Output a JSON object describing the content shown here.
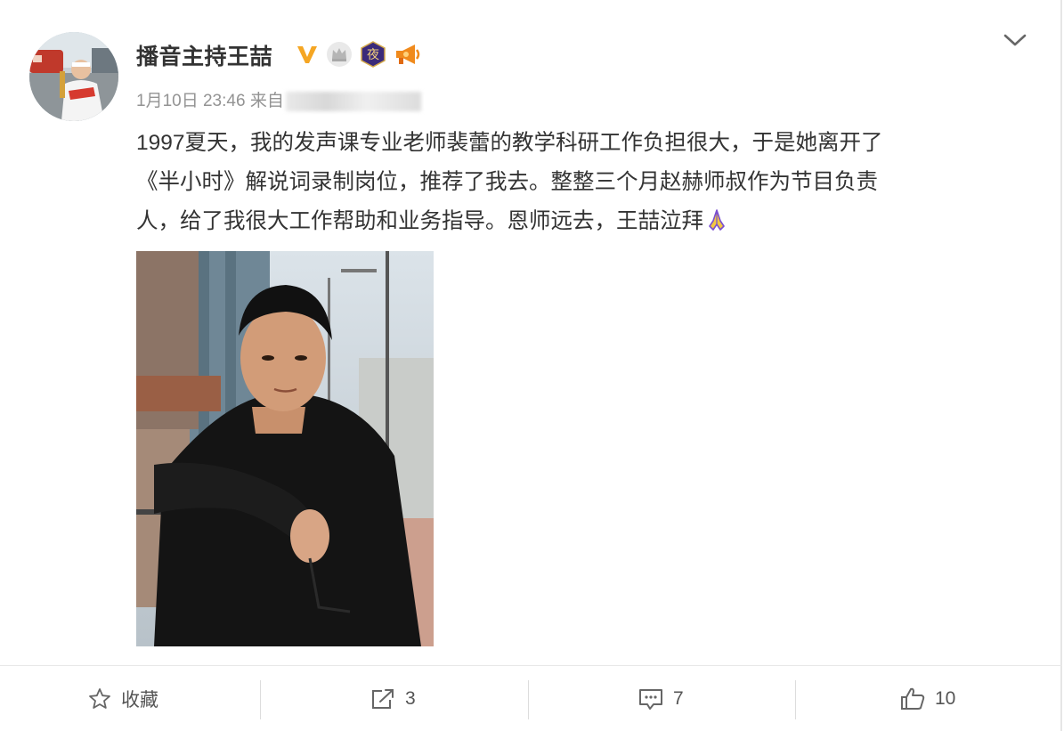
{
  "post": {
    "author": "播音主持王喆",
    "timestamp": "1月10日 23:46",
    "source_prefix": "来自",
    "text_line1": "1997夏天，我的发声课专业老师裴蕾的教学科研工作负担很大，于是她离开了",
    "text_line2": "《半小时》解说词录制岗位，推荐了我去。整整三个月赵赫师叔作为节目负责",
    "text_line3": "人，给了我很大工作帮助和业务指导。恩师远去，王喆泣拜",
    "badges": {
      "verified": "V",
      "night": "夜",
      "icons": [
        "verified-v-icon",
        "crown-icon",
        "night-badge-icon",
        "megaphone-icon"
      ]
    },
    "emoji": "praying-hands-icon"
  },
  "actions": {
    "favorite": "收藏",
    "repost_count": "3",
    "comment_count": "7",
    "like_count": "10"
  },
  "colors": {
    "verified_orange": "#f5a623",
    "night_purple": "#3b2a7a",
    "megaphone_orange": "#f08a1c",
    "text": "#333333",
    "meta": "#939393"
  }
}
